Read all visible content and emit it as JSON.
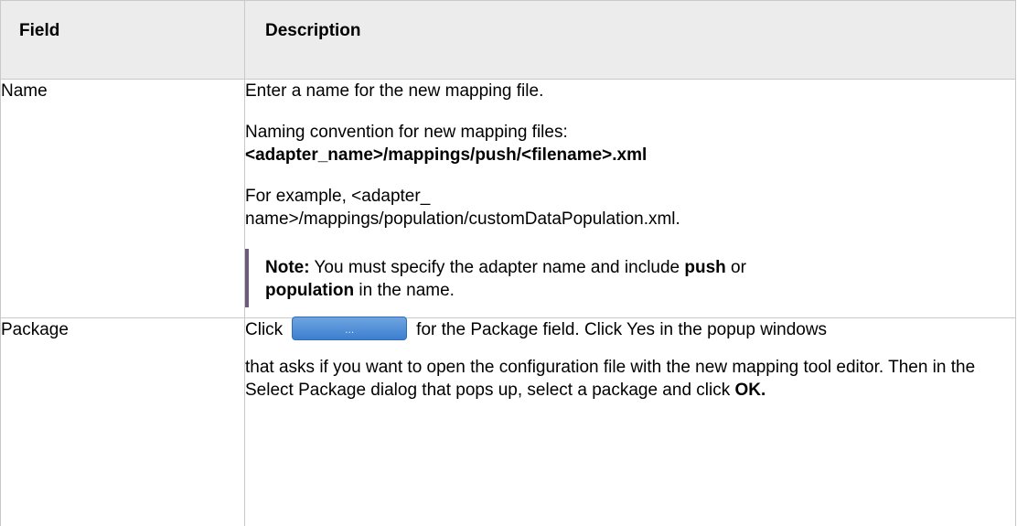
{
  "header": {
    "col_field": "Field",
    "col_description": "Description"
  },
  "rows": [
    {
      "field": "Name",
      "p1": "Enter a name for the new mapping file.",
      "p2_text": "Naming convention for new mapping files:",
      "p2_bold": "<adapter_name>/mappings/push/<filename>.xml",
      "p3_line1": "For example, <adapter_",
      "p3_line2": "name>/mappings/population/customDataPopulation.xml.",
      "note_label": "Note:",
      "note_text1": " You must specify the adapter name and include ",
      "note_bold1": "push",
      "note_text2": " or",
      "note_bold2": "population",
      "note_text3": " in the name."
    },
    {
      "field": "Package",
      "click_text": "Click",
      "button_label": "...",
      "after_button": "for the Package field. Click Yes in the popup windows",
      "p2": "that asks if you want to open the configuration file with the new mapping tool editor. Then in the Select Package dialog that pops up, select a package and click ",
      "ok_label": "OK."
    }
  ]
}
